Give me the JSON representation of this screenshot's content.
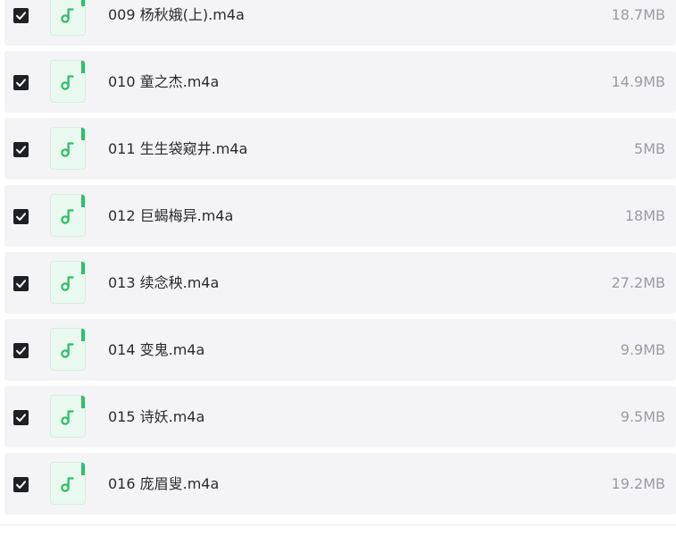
{
  "files": [
    {
      "name": "009 杨秋娥(上).m4a",
      "size": "18.7MB",
      "checked": true,
      "icon": "music-note-icon"
    },
    {
      "name": "010 童之杰.m4a",
      "size": "14.9MB",
      "checked": true,
      "icon": "music-note-icon"
    },
    {
      "name": "011 生生袋窥井.m4a",
      "size": "5MB",
      "checked": true,
      "icon": "music-note-icon"
    },
    {
      "name": "012 巨蝎梅异.m4a",
      "size": "18MB",
      "checked": true,
      "icon": "music-note-icon"
    },
    {
      "name": "013 续念秧.m4a",
      "size": "27.2MB",
      "checked": true,
      "icon": "music-note-icon"
    },
    {
      "name": "014 变鬼.m4a",
      "size": "9.9MB",
      "checked": true,
      "icon": "music-note-icon"
    },
    {
      "name": "015 诗妖.m4a",
      "size": "9.5MB",
      "checked": true,
      "icon": "music-note-icon"
    },
    {
      "name": "016 庞眉叟.m4a",
      "size": "19.2MB",
      "checked": true,
      "icon": "music-note-icon"
    }
  ],
  "colors": {
    "row_bg": "#f4f4f6",
    "checkbox": "#1f2024",
    "icon_green": "#2fbf6a",
    "icon_bg": "#e9f9ef",
    "name_text": "#2a2b2e",
    "size_text": "#9a9ca3"
  }
}
